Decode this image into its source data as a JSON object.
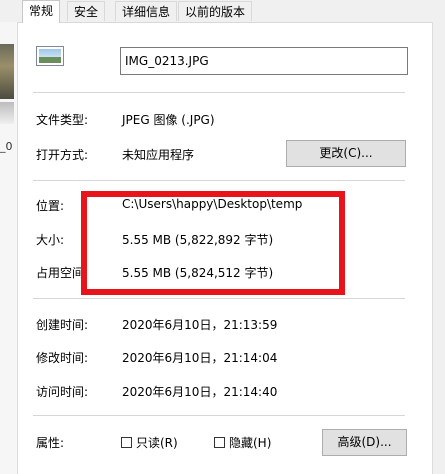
{
  "tabs": [
    "常规",
    "安全",
    "详细信息",
    "以前的版本"
  ],
  "left_strip": {
    "text": "_0"
  },
  "file": {
    "name": "IMG_0213.JPG",
    "icon": "image-file-icon"
  },
  "type": {
    "label": "文件类型:",
    "value": "JPEG 图像 (.JPG)"
  },
  "open_with": {
    "label": "打开方式:",
    "value": "未知应用程序",
    "button": "更改(C)..."
  },
  "location": {
    "label": "位置:",
    "value": "C:\\Users\\happy\\Desktop\\temp"
  },
  "size": {
    "label": "大小:",
    "value": "5.55 MB (5,822,892 字节)"
  },
  "size_on_disk": {
    "label": "占用空间",
    "value": "5.55 MB (5,824,512 字节)"
  },
  "created": {
    "label": "创建时间:",
    "value": "2020年6月10日，21:13:59"
  },
  "modified": {
    "label": "修改时间:",
    "value": "2020年6月10日，21:14:04"
  },
  "accessed": {
    "label": "访问时间:",
    "value": "2020年6月10日，21:14:40"
  },
  "attributes": {
    "label": "属性:",
    "readonly": "只读(R)",
    "hidden": "隐藏(H)",
    "advanced": "高级(D)..."
  },
  "colors": {
    "highlight": "#e8141b"
  }
}
